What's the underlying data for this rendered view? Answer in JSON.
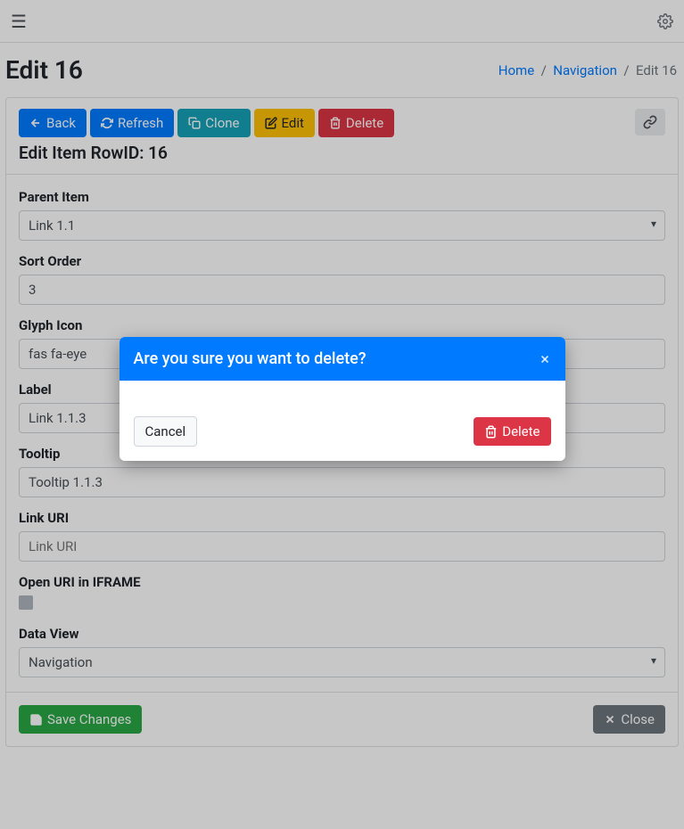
{
  "header": {
    "title": "Edit 16"
  },
  "breadcrumb": {
    "home": "Home",
    "nav": "Navigation",
    "current": "Edit 16",
    "sep": "/"
  },
  "toolbar": {
    "back": "Back",
    "refresh": "Refresh",
    "clone": "Clone",
    "edit": "Edit",
    "delete": "Delete"
  },
  "card": {
    "subtitle": "Edit Item RowID: 16"
  },
  "form": {
    "parent_item": {
      "label": "Parent Item",
      "value": "Link 1.1"
    },
    "sort_order": {
      "label": "Sort Order",
      "value": "3"
    },
    "glyph_icon": {
      "label": "Glyph Icon",
      "value": "fas fa-eye"
    },
    "label_field": {
      "label": "Label",
      "value": "Link 1.1.3"
    },
    "tooltip": {
      "label": "Tooltip",
      "value": "Tooltip 1.1.3"
    },
    "link_uri": {
      "label": "Link URI",
      "placeholder": "Link URI",
      "value": ""
    },
    "open_iframe": {
      "label": "Open URI in IFRAME",
      "checked": false
    },
    "data_view": {
      "label": "Data View",
      "value": "Navigation"
    }
  },
  "footer": {
    "save": "Save Changes",
    "close": "Close"
  },
  "modal": {
    "title": "Are you sure you want to delete?",
    "cancel": "Cancel",
    "delete": "Delete"
  }
}
